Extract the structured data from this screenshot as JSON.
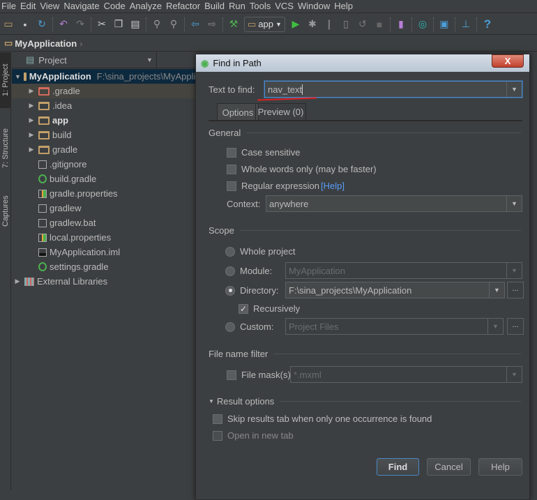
{
  "menu": [
    "File",
    "Edit",
    "View",
    "Navigate",
    "Code",
    "Analyze",
    "Refactor",
    "Build",
    "Run",
    "Tools",
    "VCS",
    "Window",
    "Help"
  ],
  "toolbar": {
    "run_config": "app"
  },
  "breadcrumb": "MyApplication",
  "side_tabs": [
    "1: Project",
    "7: Structure",
    "Captures"
  ],
  "panel": {
    "title": "Project"
  },
  "tree": {
    "root": {
      "label": "MyApplication",
      "path": "F:\\sina_projects\\MyApplication"
    },
    "items": [
      {
        "label": ".gradle",
        "type": "folder-excluded",
        "expandable": true
      },
      {
        "label": ".idea",
        "type": "folder",
        "expandable": true
      },
      {
        "label": "app",
        "type": "module",
        "expandable": true
      },
      {
        "label": "build",
        "type": "folder",
        "expandable": true
      },
      {
        "label": "gradle",
        "type": "folder",
        "expandable": true
      },
      {
        "label": ".gitignore",
        "type": "text"
      },
      {
        "label": "build.gradle",
        "type": "gradle"
      },
      {
        "label": "gradle.properties",
        "type": "properties"
      },
      {
        "label": "gradlew",
        "type": "text"
      },
      {
        "label": "gradlew.bat",
        "type": "text"
      },
      {
        "label": "local.properties",
        "type": "properties"
      },
      {
        "label": "MyApplication.iml",
        "type": "iml"
      },
      {
        "label": "settings.gradle",
        "type": "gradle"
      }
    ],
    "external": "External Libraries"
  },
  "dialog": {
    "title": "Find in Path",
    "close": "X",
    "text_to_find_label": "Text to find:",
    "text_to_find_value": "nav_text",
    "tabs": [
      "Options",
      "Preview (0)"
    ],
    "general": "General",
    "case_sensitive": "Case sensitive",
    "whole_words": "Whole words only (may be faster)",
    "regex": "Regular expression",
    "help_link": "[Help]",
    "context_label": "Context:",
    "context_value": "anywhere",
    "scope": "Scope",
    "whole_project": "Whole project",
    "module_label": "Module:",
    "module_value": "MyApplication",
    "directory_label": "Directory:",
    "directory_value": "F:\\sina_projects\\MyApplication",
    "recursively": "Recursively",
    "custom_label": "Custom:",
    "custom_value": "Project Files",
    "dots": "...",
    "file_filter": "File name filter",
    "file_mask": "File mask(s)",
    "file_mask_value": "*.mxml",
    "result_options": "Result options",
    "skip_results": "Skip results tab when only one occurrence is found",
    "open_new_tab": "Open in new tab",
    "find": "Find",
    "cancel": "Cancel",
    "help": "Help"
  },
  "colors": {
    "accent": "#4a88c7",
    "selection": "#0d293e",
    "underline_mark": "#e02020"
  }
}
